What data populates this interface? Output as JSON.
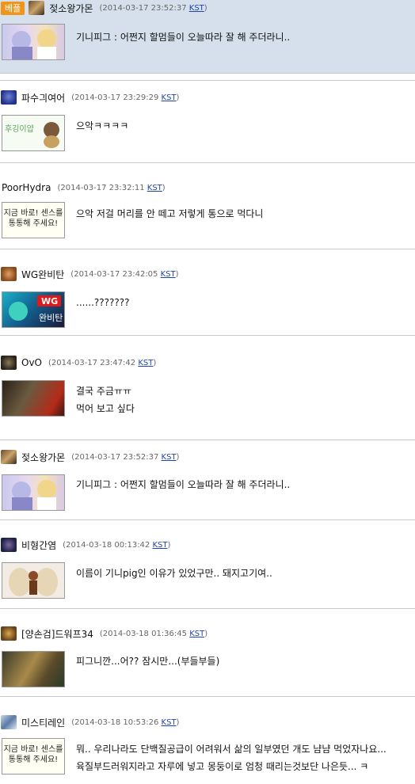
{
  "comments": [
    {
      "badge": "베플",
      "name": "젖소왕가몬",
      "date": "2014-03-17 23:52:37",
      "tz": "KST",
      "lines": [
        "기니피그 : 어쩐지 할멈들이 오늘따라 잘 해 주더라니.."
      ]
    },
    {
      "name": "파수긔여어",
      "date": "2014-03-17 23:29:29",
      "tz": "KST",
      "lines": [
        "으악ㅋㅋㅋㅋ"
      ]
    },
    {
      "name": "PoorHydra",
      "date": "2014-03-17 23:32:11",
      "tz": "KST",
      "lines": [
        "으악 저걸 머리를 안 떼고 저렇게 통으로 먹다니"
      ]
    },
    {
      "name": "WG완비탄",
      "date": "2014-03-17 23:42:05",
      "tz": "KST",
      "lines": [
        "......???????"
      ]
    },
    {
      "name": "OvO",
      "date": "2014-03-17 23:47:42",
      "tz": "KST",
      "lines": [
        "결국 주금ㅠㅠ",
        "먹어 보고 싶다"
      ]
    },
    {
      "name": "젖소왕가몬",
      "date": "2014-03-17 23:52:37",
      "tz": "KST",
      "lines": [
        "기니피그 : 어쩐지 할멈들이 오늘따라 잘 해 주더라니.."
      ]
    },
    {
      "name": "비형간염",
      "date": "2014-03-18 00:13:42",
      "tz": "KST",
      "lines": [
        "이름이 기니pig인 이유가 있었구만.. 돼지고기여.."
      ]
    },
    {
      "name": "[양손검]드워프34",
      "date": "2014-03-18 01:36:45",
      "tz": "KST",
      "lines": [
        "피그니깐...어?? 잠시만...(부들부들)"
      ]
    },
    {
      "name": "미스티레인",
      "date": "2014-03-18 10:53:26",
      "tz": "KST",
      "lines": [
        "뭐.. 우리나라도 단백질공급이 어려워서 삶의 일부였던 개도 냠냠 먹었자나요...",
        "육질부드러워지라고 자루에 넣고 몽둥이로 엄청 때리는것보단 나은듯... ㅋ"
      ]
    }
  ],
  "avatars": {
    "sign_text_1": "지금 바로! 센스를",
    "sign_text_2": "통통해 주세요!",
    "wg_label": "WG",
    "wg_sub": "완비탄",
    "paper_text": "후깅이얍"
  },
  "colors": {
    "highlight_bg": "#d6e0ec",
    "badge_bg": "#f0941c",
    "separator": "#c9c9c9",
    "link": "#2244aa"
  }
}
